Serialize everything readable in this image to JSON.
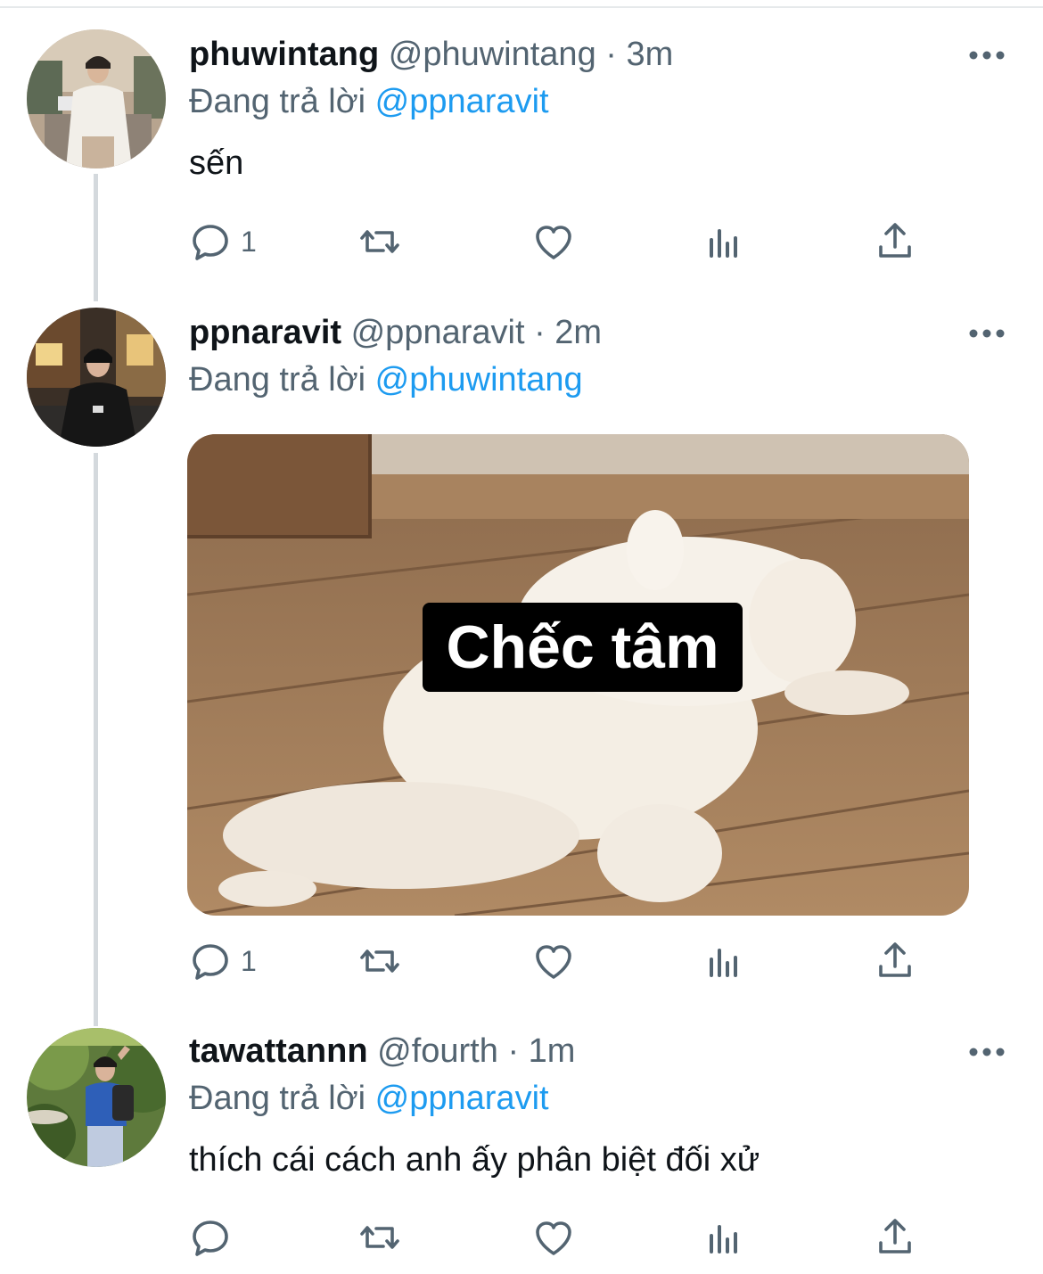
{
  "colors": {
    "link": "#1d9bf0",
    "muted": "#536471",
    "text": "#0f1419",
    "thread_line": "#d4d9dd"
  },
  "tweets": [
    {
      "name": "phuwintang",
      "handle": "@phuwintang",
      "separator": "·",
      "time": "3m",
      "reply_prefix": "Đang trả lời",
      "reply_to": "@ppnaravit",
      "text": "sến",
      "reply_count": "1",
      "icons": [
        "reply-icon",
        "retweet-icon",
        "like-icon",
        "views-icon",
        "share-icon",
        "more-icon"
      ]
    },
    {
      "name": "ppnaravit",
      "handle": "@ppnaravit",
      "separator": "·",
      "time": "2m",
      "reply_prefix": "Đang trả lời",
      "reply_to": "@phuwintang",
      "media_caption": "Chếc tâm",
      "reply_count": "1",
      "icons": [
        "reply-icon",
        "retweet-icon",
        "like-icon",
        "views-icon",
        "share-icon",
        "more-icon"
      ]
    },
    {
      "name": "tawattannn",
      "handle": "@fourth",
      "separator": "·",
      "time": "1m",
      "reply_prefix": "Đang trả lời",
      "reply_to": "@ppnaravit",
      "text": "thích cái cách anh ấy phân biệt đối xử",
      "reply_count": "",
      "icons": [
        "reply-icon",
        "retweet-icon",
        "like-icon",
        "views-icon",
        "share-icon",
        "more-icon"
      ]
    }
  ]
}
